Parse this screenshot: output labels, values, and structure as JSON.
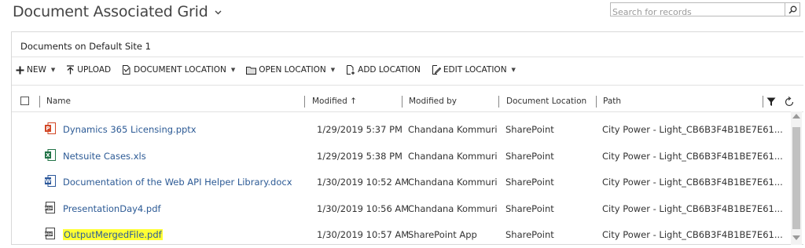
{
  "page": {
    "title": "Document Associated Grid",
    "subtitle": "Documents on Default Site 1"
  },
  "search": {
    "placeholder": "Search for records",
    "icon": "search-icon"
  },
  "toolbar": {
    "new_label": "NEW",
    "upload_label": "UPLOAD",
    "document_location_label": "DOCUMENT LOCATION",
    "open_location_label": "OPEN LOCATION",
    "add_location_label": "ADD LOCATION",
    "edit_location_label": "EDIT LOCATION"
  },
  "grid": {
    "columns": {
      "name": "Name",
      "modified": "Modified ↑",
      "modified_by": "Modified by",
      "document_location": "Document Location",
      "path": "Path"
    },
    "rows": [
      {
        "name": "Dynamics 365 Licensing.pptx",
        "file_type": "pptx",
        "modified": "1/29/2019 5:37 PM",
        "modified_by": "Chandana Kommuri",
        "document_location": "SharePoint",
        "path": "City Power - Light_CB6B3F4B1BE7E61..."
      },
      {
        "name": "Netsuite Cases.xls",
        "file_type": "xls",
        "modified": "1/29/2019 5:38 PM",
        "modified_by": "Chandana Kommuri",
        "document_location": "SharePoint",
        "path": "City Power - Light_CB6B3F4B1BE7E61..."
      },
      {
        "name": "Documentation of the Web API Helper Library.docx",
        "file_type": "docx",
        "modified": "1/30/2019 10:52 AM",
        "modified_by": "Chandana Kommuri",
        "document_location": "SharePoint",
        "path": "City Power - Light_CB6B3F4B1BE7E61..."
      },
      {
        "name": "PresentationDay4.pdf",
        "file_type": "pdf",
        "modified": "1/30/2019 10:56 AM",
        "modified_by": "Chandana Kommuri",
        "document_location": "SharePoint",
        "path": "City Power - Light_CB6B3F4B1BE7E61..."
      },
      {
        "name": "OutputMergedFile.pdf",
        "file_type": "pdf",
        "highlighted": true,
        "modified": "1/30/2019 10:57 AM",
        "modified_by": "SharePoint App",
        "document_location": "SharePoint",
        "path": "City Power - Light_CB6B3F4B1BE7E61..."
      }
    ]
  },
  "colors": {
    "link": "#2c5a95",
    "highlight": "#ffff33",
    "pptx": "#d24726",
    "xls": "#217346",
    "docx": "#2b579a",
    "pdf": "#444444"
  }
}
